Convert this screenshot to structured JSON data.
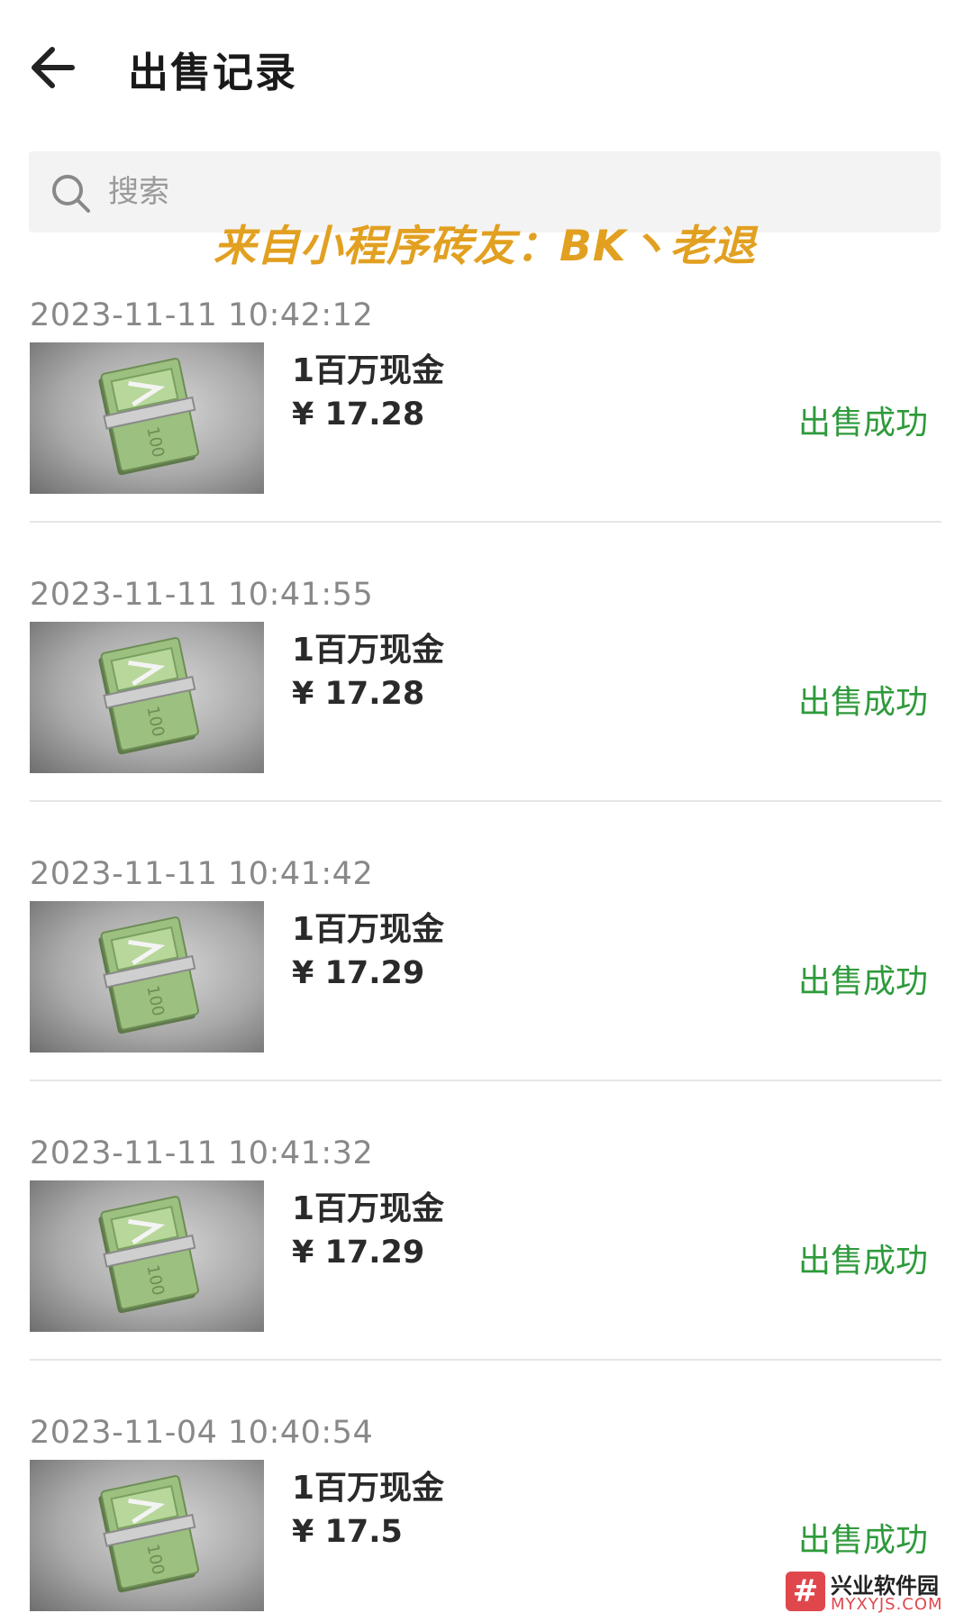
{
  "header": {
    "title": "出售记录"
  },
  "search": {
    "placeholder": "搜索"
  },
  "watermark": {
    "text": "来自小程序砖友：BK丶老退"
  },
  "records": [
    {
      "time": "2023-11-11 10:42:12",
      "name": "1百万现金",
      "price": "¥ 17.28",
      "status": "出售成功"
    },
    {
      "time": "2023-11-11 10:41:55",
      "name": "1百万现金",
      "price": "¥ 17.28",
      "status": "出售成功"
    },
    {
      "time": "2023-11-11 10:41:42",
      "name": "1百万现金",
      "price": "¥ 17.29",
      "status": "出售成功"
    },
    {
      "time": "2023-11-11 10:41:32",
      "name": "1百万现金",
      "price": "¥ 17.29",
      "status": "出售成功"
    },
    {
      "time": "2023-11-04 10:40:54",
      "name": "1百万现金",
      "price": "¥ 17.5",
      "status": "出售成功"
    }
  ],
  "logo": {
    "symbol": "#",
    "title": "兴业软件园",
    "url": "MYXYJS.COM"
  },
  "colors": {
    "status_success": "#2e9a3b",
    "watermark": "#e2a021",
    "logo_red": "#e0474c"
  },
  "icons": {
    "back": "arrow-left-icon",
    "search": "search-icon",
    "thumbnail": "cash-stack-icon"
  }
}
